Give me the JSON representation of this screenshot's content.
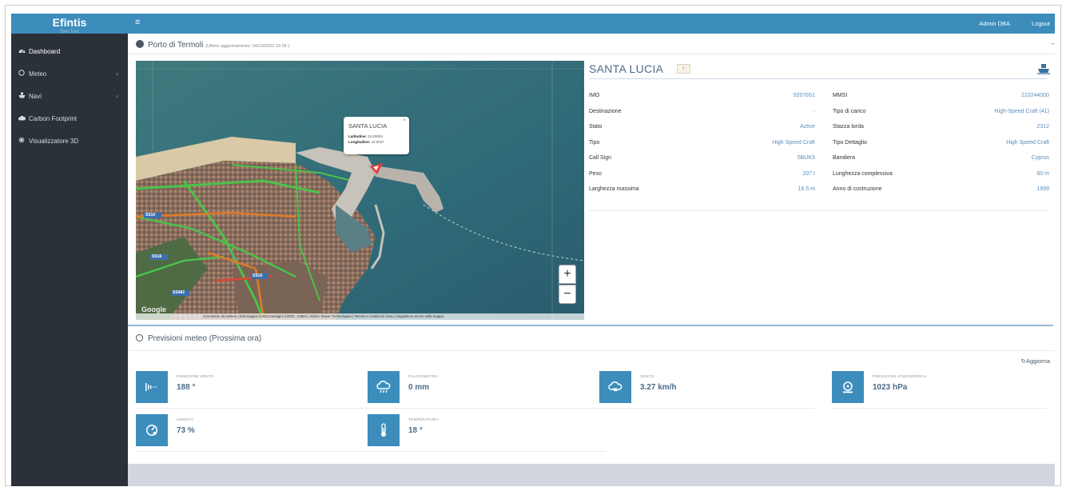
{
  "brand": {
    "name": "Efintis",
    "sub": "Dev Tool"
  },
  "sidebar": {
    "items": [
      {
        "label": "Dashboard",
        "icon": "dashboard-icon"
      },
      {
        "label": "Meteo",
        "icon": "circle-icon",
        "chevron": "‹"
      },
      {
        "label": "Navi",
        "icon": "ship-icon",
        "chevron": "‹"
      },
      {
        "label": "Carbon Footprint",
        "icon": "cloud-icon"
      },
      {
        "label": "Visualizzatore 3D",
        "icon": "cube-icon"
      }
    ]
  },
  "topbar": {
    "menu_icon": "≡",
    "user": "Admin DBA",
    "logout": "Logout"
  },
  "port": {
    "title": "Porto di Termoli",
    "updated": "(Ultimo aggiornamento: 04/10/2022 19:16 )",
    "collapse": "–"
  },
  "map": {
    "popup": {
      "title": "SANTA LUCIA",
      "close": "×",
      "lat_label": "Latitudine:",
      "lat": "15.00054",
      "lon_label": "Longitudine:",
      "lon": "42.0047"
    },
    "zoom_in": "+",
    "zoom_out": "−",
    "google": "Google",
    "attribution": "Scorciatoie da tastiera | Dati mappa ©2022 Immagini ©2022 , CNES / Airbus, Maxar Technologies | Termini e condizioni d'uso | Segnala un errore nella mappa",
    "road_labels": [
      "SS16",
      "SS16",
      "SS16",
      "SS482"
    ]
  },
  "ship": {
    "name": "SANTA LUCIA",
    "flag": "🇨🇾",
    "left": [
      {
        "label": "IMO",
        "value": "9207651"
      },
      {
        "label": "Destinazione",
        "value": "-"
      },
      {
        "label": "Stato",
        "value": "Active"
      },
      {
        "label": "Tipo",
        "value": "High Speed Craft"
      },
      {
        "label": "Call Sign",
        "value": "5BUK5"
      },
      {
        "label": "Peso",
        "value": "207 t"
      },
      {
        "label": "Larghezza massima",
        "value": "16.5 m"
      }
    ],
    "right": [
      {
        "label": "MMSI",
        "value": "210244000"
      },
      {
        "label": "Tipo di carico",
        "value": "High-Speed Craft (41)"
      },
      {
        "label": "Stazza lorda",
        "value": "2312"
      },
      {
        "label": "Tipo Dettaglio",
        "value": "High Speed Craft"
      },
      {
        "label": "Bandiera",
        "value": "Cyprus"
      },
      {
        "label": "Lunghezza complessiva",
        "value": "60 m"
      },
      {
        "label": "Anno di costruzione",
        "value": "1999"
      }
    ]
  },
  "weather": {
    "title": "Previsioni meteo (Prossima ora)",
    "refresh": "Aggiorna",
    "cards": [
      {
        "label": "Direzione vento",
        "value": "188 °",
        "icon": "wind-direction-icon"
      },
      {
        "label": "Pluviometro",
        "value": "0 mm",
        "icon": "rain-cloud-icon"
      },
      {
        "label": "Vento",
        "value": "3.27 km/h",
        "icon": "wind-cloud-icon"
      },
      {
        "label": "Pressione atmosferica",
        "value": "1023 hPa",
        "icon": "pressure-icon"
      },
      {
        "label": "Umidità",
        "value": "73 %",
        "icon": "humidity-gauge-icon"
      },
      {
        "label": "Temperatura",
        "value": "18 °",
        "icon": "thermometer-icon"
      }
    ]
  },
  "colors": {
    "primary": "#3c8dbc",
    "sidebar": "#2b3138",
    "link": "#5b8fbe"
  }
}
